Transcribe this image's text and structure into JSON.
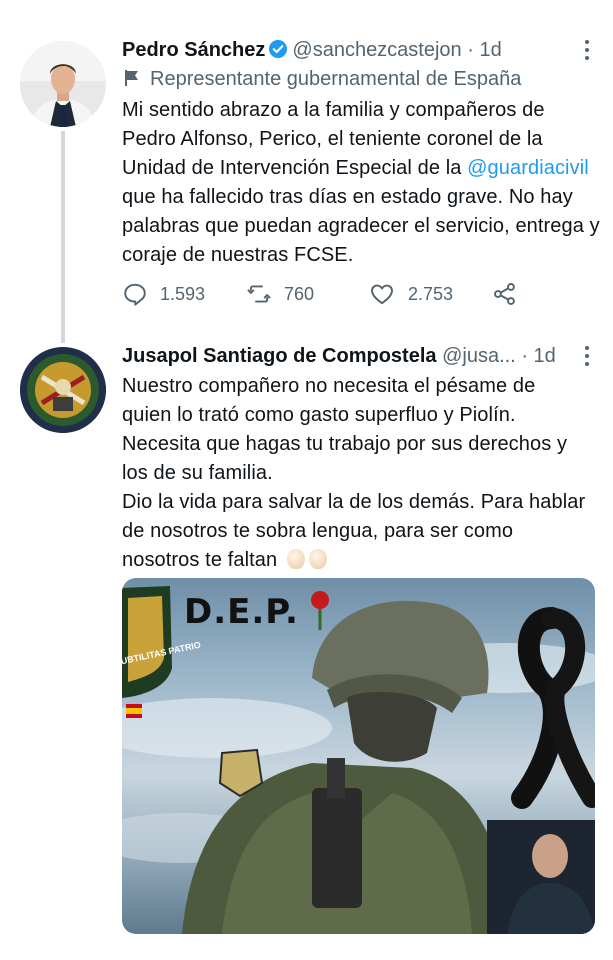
{
  "tweet1": {
    "name": "Pedro Sánchez",
    "handle": "@sanchezcastejon",
    "separator": "·",
    "time": "1d",
    "label": "Representante gubernamental de España",
    "text_parts": {
      "before": "Mi sentido abrazo a la familia y compañeros de Pedro Alfonso, Perico, el teniente coronel de la Unidad de Intervención Especial de la ",
      "mention": "@guardiacivil",
      "after": " que ha fallecido tras días en estado grave. No hay palabras que puedan agradecer el servicio, entrega y coraje de nuestras FCSE."
    },
    "stats": {
      "replies": "1.593",
      "retweets": "760",
      "likes": "2.753"
    }
  },
  "tweet2": {
    "name": "Jusapol Santiago de Compostela",
    "handle": "@jusa...",
    "separator": "·",
    "time": "1d",
    "text_lines": [
      "Nuestro compañero no necesita el pésame de",
      "quien lo trató como gasto superfluo y Piolín.",
      "Necesita que hagas tu trabajo por sus derechos y",
      "los de su familia.",
      "Dio la vida para salvar la de los demás. Para hablar",
      "de nosotros te sobra lengua, para ser como",
      "nosotros te faltan"
    ],
    "media": {
      "headline": "D.E.P.",
      "badge_text": "UBTILITAS PATRIO"
    }
  },
  "colors": {
    "text": "#0f1419",
    "secondary": "#536471",
    "accent": "#1d9bf0",
    "thread_line": "#cfd9de"
  }
}
